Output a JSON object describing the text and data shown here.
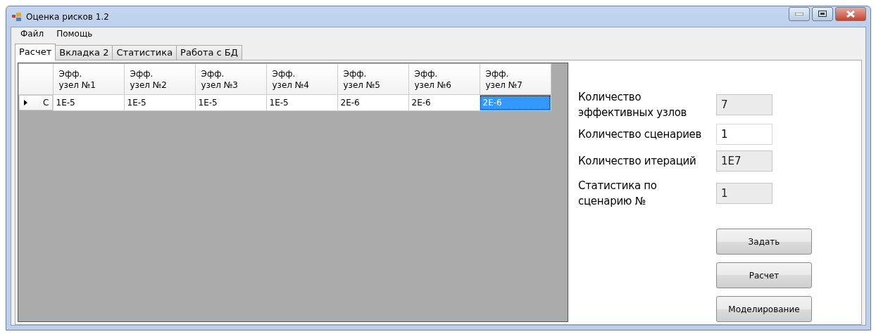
{
  "window": {
    "title": "Оценка рисков  1.2"
  },
  "menu": [
    "Файл",
    "Помощь"
  ],
  "tabs": [
    {
      "label": "Расчет",
      "selected": true
    },
    {
      "label": "Вкладка 2",
      "selected": false
    },
    {
      "label": "Статистика",
      "selected": false
    },
    {
      "label": "Работа с БД",
      "selected": false
    }
  ],
  "table": {
    "columns": [
      "Эфф.\nузел №1",
      "Эфф.\nузел №2",
      "Эфф.\nузел №3",
      "Эфф.\nузел №4",
      "Эфф.\nузел №5",
      "Эфф.\nузел №6",
      "Эфф.\nузел №7"
    ],
    "rows": [
      {
        "header": "C",
        "current": true,
        "cells": [
          {
            "text": "1E-5",
            "selected": false
          },
          {
            "text": "1E-5",
            "selected": false
          },
          {
            "text": "1E-5",
            "selected": false
          },
          {
            "text": "1E-5",
            "selected": false
          },
          {
            "text": "2E-6",
            "selected": false
          },
          {
            "text": "2E-6",
            "selected": false
          },
          {
            "text": "2E-6",
            "selected": true
          }
        ]
      }
    ]
  },
  "fields": [
    {
      "label": "Количество\nэффективных узлов",
      "value": "7",
      "readonly": true
    },
    {
      "label": "Количество сценариев",
      "value": "1",
      "readonly": false
    },
    {
      "label": "Количество итераций",
      "value": "1E7",
      "readonly": true
    },
    {
      "label": "Статистика по\nсценарию №",
      "value": "1",
      "readonly": true
    }
  ],
  "buttons": [
    "Задать",
    "Расчет",
    "Моделирование"
  ]
}
